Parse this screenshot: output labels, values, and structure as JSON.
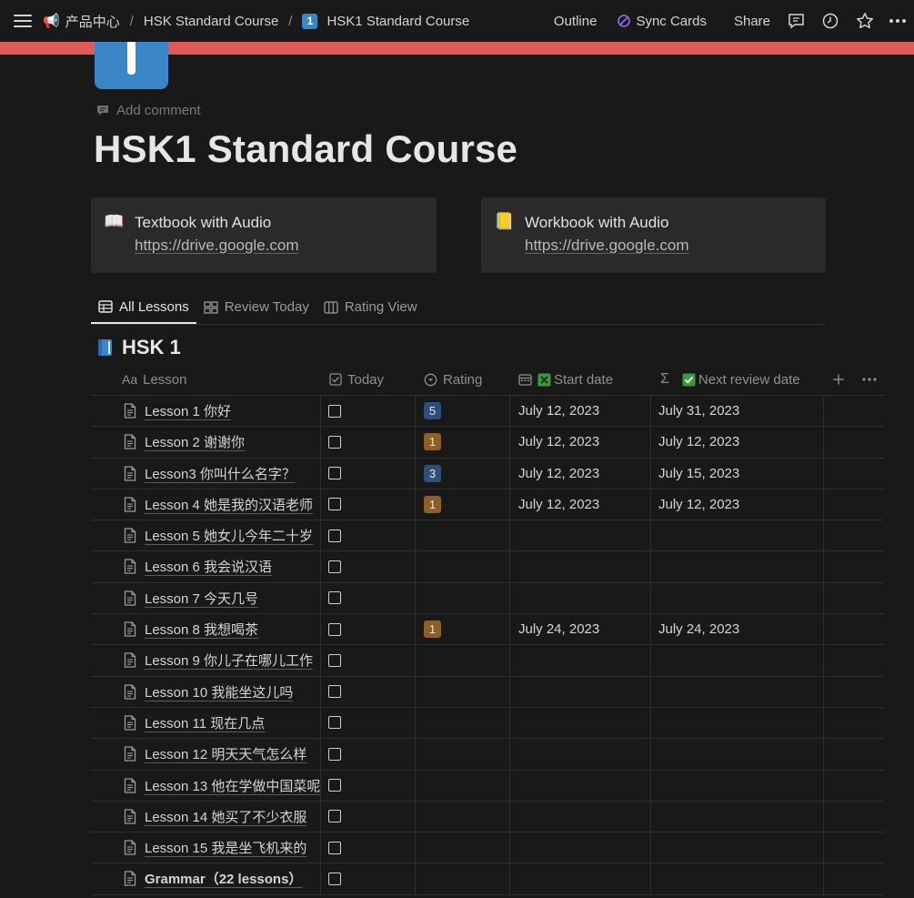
{
  "topbar": {
    "breadcrumb": [
      {
        "label": "产品中心"
      },
      {
        "label": "HSK Standard Course"
      },
      {
        "label": "HSK1 Standard Course"
      }
    ],
    "outline_label": "Outline",
    "sync_label": "Sync Cards",
    "share_label": "Share"
  },
  "page": {
    "add_comment": "Add comment",
    "title": "HSK1 Standard Course"
  },
  "cards": [
    {
      "label": "Textbook with Audio",
      "url": "https://drive.google.com"
    },
    {
      "label": "Workbook with Audio",
      "url": "https://drive.google.com"
    }
  ],
  "tabs": [
    {
      "label": "All Lessons",
      "active": true
    },
    {
      "label": "Review Today",
      "active": false
    },
    {
      "label": "Rating View",
      "active": false
    }
  ],
  "group": {
    "title": "HSK 1"
  },
  "columns": {
    "lesson": "Lesson",
    "today": "Today",
    "rating": "Rating",
    "start": "Start date",
    "next": "Next review date"
  },
  "rows": [
    {
      "lesson": "Lesson 1 你好",
      "rating": "5",
      "start": "July 12, 2023",
      "next": "July 31, 2023"
    },
    {
      "lesson": "Lesson 2 谢谢你",
      "rating": "1",
      "start": "July 12, 2023",
      "next": "July 12, 2023"
    },
    {
      "lesson": "Lesson3 你叫什么名字？",
      "rating": "3",
      "start": "July 12, 2023",
      "next": "July 15, 2023"
    },
    {
      "lesson": "Lesson 4 她是我的汉语老师",
      "rating": "1",
      "start": "July 12, 2023",
      "next": "July 12, 2023"
    },
    {
      "lesson": "Lesson 5 她女儿今年二十岁",
      "rating": "",
      "start": "",
      "next": ""
    },
    {
      "lesson": "Lesson 6 我会说汉语",
      "rating": "",
      "start": "",
      "next": ""
    },
    {
      "lesson": "Lesson 7 今天几号",
      "rating": "",
      "start": "",
      "next": ""
    },
    {
      "lesson": "Lesson 8 我想喝茶",
      "rating": "1",
      "start": "July 24, 2023",
      "next": "July 24, 2023"
    },
    {
      "lesson": "Lesson 9 你儿子在哪儿工作",
      "rating": "",
      "start": "",
      "next": ""
    },
    {
      "lesson": "Lesson 10 我能坐这儿吗",
      "rating": "",
      "start": "",
      "next": ""
    },
    {
      "lesson": "Lesson 11 现在几点",
      "rating": "",
      "start": "",
      "next": ""
    },
    {
      "lesson": "Lesson 12 明天天气怎么样",
      "rating": "",
      "start": "",
      "next": ""
    },
    {
      "lesson": "Lesson 13 他在学做中国菜呢",
      "rating": "",
      "start": "",
      "next": ""
    },
    {
      "lesson": "Lesson 14 她买了不少衣服",
      "rating": "",
      "start": "",
      "next": ""
    },
    {
      "lesson": "Lesson 15 我是坐飞机来的",
      "rating": "",
      "start": "",
      "next": ""
    },
    {
      "lesson": "Grammar（22 lessons）",
      "rating": "",
      "start": "",
      "next": "",
      "bold": true
    }
  ],
  "rating_colors": {
    "5": "#2f4f7a",
    "3": "#2f4f7a",
    "1": "#8a5f2a"
  },
  "colors": {
    "accent_band": "#e05a5a",
    "page_icon": "#3a86c8",
    "sync_icon": "#9b6cff"
  }
}
